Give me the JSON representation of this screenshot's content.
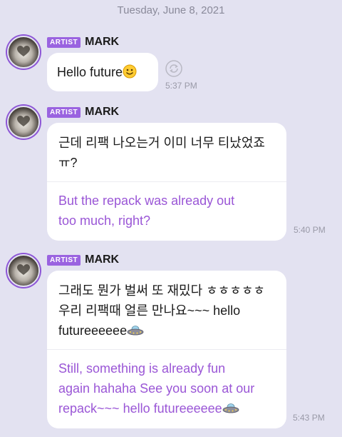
{
  "date_label": "Tuesday, June 8, 2021",
  "messages": [
    {
      "badge": "ARTIST",
      "sender": "MARK",
      "text": "Hello future",
      "time": "5:37 PM"
    },
    {
      "badge": "ARTIST",
      "sender": "MARK",
      "text_line1": "근데 리팩 나오는거 이미 너무 티났었죠",
      "text_line2": "ㅠ?",
      "translation_line1": "But the repack was already out",
      "translation_line2": "too much, right?",
      "time": "5:40 PM"
    },
    {
      "badge": "ARTIST",
      "sender": "MARK",
      "text_line1": "그래도 뭔가 벌써 또 재밌다 ㅎㅎㅎㅎㅎ",
      "text_line2": "우리 리팩때 얼른 만나요~~~ hello",
      "text_line3": "futureeeeee",
      "translation_line1": "Still, something is already fun",
      "translation_line2": "again hahaha See you soon at our",
      "translation_line3": "repack~~~ hello futureeeeee",
      "time": "5:43 PM"
    }
  ],
  "colors": {
    "background": "#e3e2f1",
    "badge": "#9a63e0",
    "translation_text": "#9a56d6",
    "time_text": "#9a9aa8"
  },
  "icons": [
    "smiley-emoji",
    "ufo-emoji",
    "translate-icon",
    "heart-hands-avatar"
  ]
}
